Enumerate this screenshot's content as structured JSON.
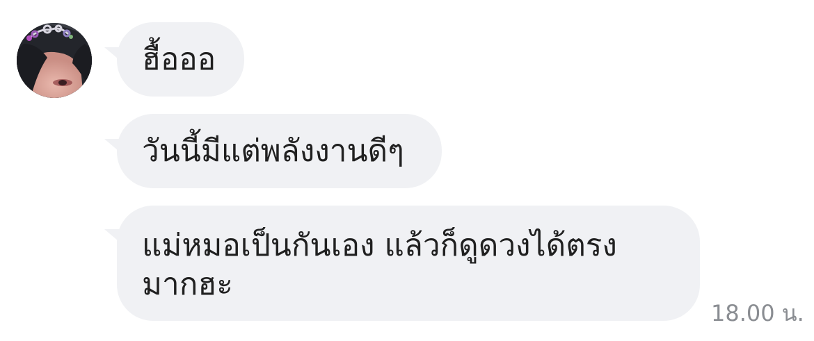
{
  "chat": {
    "avatar_icon": "user-avatar-photo",
    "messages": [
      {
        "text": "ฮื้อออ"
      },
      {
        "text": "วันนี้มีแต่พลังงานดีๆ"
      },
      {
        "text": "แม่หมอเป็นกันเอง แล้วก็ดูดวงได้ตรงมากฮะ"
      }
    ],
    "timestamp": "18.00 น."
  },
  "colors": {
    "bubble_bg": "#f0f1f4",
    "text": "#202020",
    "timestamp": "#8a8d92"
  }
}
